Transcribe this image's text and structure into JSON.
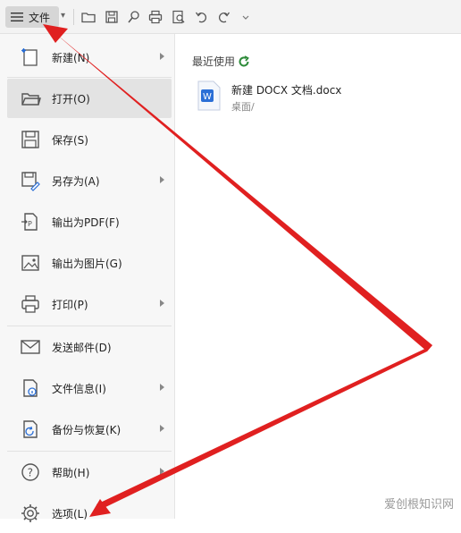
{
  "toolbar": {
    "file_label": "文件",
    "icons": [
      "menu-icon",
      "chevron-down-icon",
      "open-folder-icon",
      "save-icon",
      "print-preview-icon",
      "print-icon",
      "find-icon",
      "undo-icon",
      "redo-icon",
      "more-icon"
    ]
  },
  "menu": {
    "items": [
      {
        "label": "新建(N)",
        "icon": "new-document-icon",
        "submenu": true
      },
      {
        "label": "打开(O)",
        "icon": "open-folder-icon",
        "submenu": false,
        "active": true
      },
      {
        "label": "保存(S)",
        "icon": "save-icon",
        "submenu": false
      },
      {
        "label": "另存为(A)",
        "icon": "save-as-icon",
        "submenu": true
      },
      {
        "label": "输出为PDF(F)",
        "icon": "export-pdf-icon",
        "submenu": false
      },
      {
        "label": "输出为图片(G)",
        "icon": "export-image-icon",
        "submenu": false
      },
      {
        "label": "打印(P)",
        "icon": "print-icon",
        "submenu": true
      },
      {
        "label": "发送邮件(D)",
        "icon": "mail-icon",
        "submenu": false
      },
      {
        "label": "文件信息(I)",
        "icon": "file-info-icon",
        "submenu": true
      },
      {
        "label": "备份与恢复(K)",
        "icon": "backup-icon",
        "submenu": true
      },
      {
        "label": "帮助(H)",
        "icon": "help-icon",
        "submenu": true
      },
      {
        "label": "选项(L)",
        "icon": "gear-icon",
        "submenu": false
      }
    ]
  },
  "recent": {
    "title": "最近使用",
    "files": [
      {
        "name": "新建 DOCX 文档.docx",
        "path": "桌面/",
        "icon": "word-doc-icon"
      }
    ]
  },
  "watermark": "爱创根知识网",
  "colors": {
    "arrow": "#e02020",
    "accent": "#2e8b3a",
    "word_blue": "#2b6fd6"
  }
}
